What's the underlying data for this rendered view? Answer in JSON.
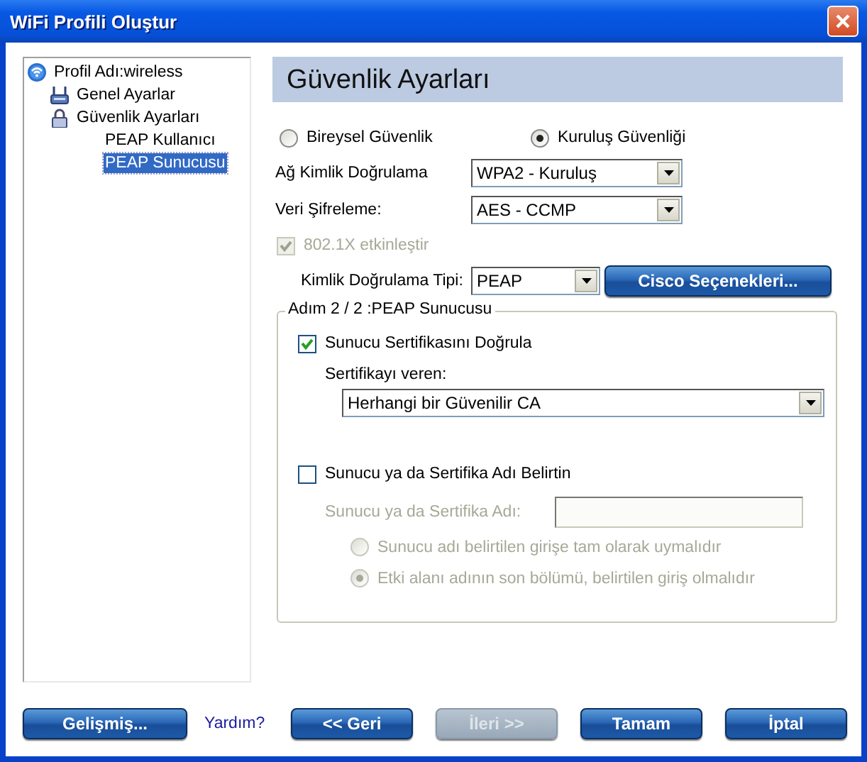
{
  "window": {
    "title": "WiFi Profili Oluştur"
  },
  "tree": [
    {
      "label": "Profil Adı:wireless",
      "selected": false,
      "children": [
        {
          "label": "Genel Ayarlar",
          "selected": false
        },
        {
          "label": "Güvenlik Ayarları",
          "selected": false,
          "children": [
            {
              "label": "PEAP Kullanıcı",
              "selected": false
            },
            {
              "label": "PEAP Sunucusu",
              "selected": true
            }
          ]
        }
      ]
    }
  ],
  "header": "Güvenlik Ayarları",
  "security_modes": [
    {
      "label": "Bireysel Güvenlik",
      "selected": false
    },
    {
      "label": "Kuruluş Güvenliği",
      "selected": true
    }
  ],
  "fields": [
    {
      "label": "Ağ Kimlik Doğrulama",
      "value": "WPA2 - Kuruluş"
    },
    {
      "label": "Veri Şifreleme:",
      "value": "AES - CCMP"
    }
  ],
  "enable_8021x": {
    "label": "802.1X etkinleştir",
    "checked": true,
    "disabled": true
  },
  "auth_type": {
    "label": "Kimlik Doğrulama Tipi:",
    "value": "PEAP"
  },
  "cisco_button": {
    "label": "Cisco Seçenekleri..."
  },
  "group": {
    "title": "Adım 2 / 2 :PEAP Sunucusu",
    "validate": {
      "label": "Sunucu Sertifikasını Doğrula",
      "checked": true
    },
    "issuer_label": "Sertifikayı veren:",
    "issuer": "Herhangi bir Güvenilir CA",
    "specify": {
      "label": "Sunucu ya da Sertifika Adı Belirtin",
      "checked": false
    },
    "name_field": {
      "label": "Sunucu ya da Sertifika Adı:",
      "disabled": true
    },
    "match_options": [
      {
        "label": "Sunucu adı belirtilen girişe tam olarak uymalıdır",
        "selected": false,
        "disabled": true
      },
      {
        "label": "Etki alanı adının son bölümü, belirtilen giriş olmalıdır",
        "selected": true,
        "disabled": true
      }
    ]
  },
  "advanced_button": {
    "label": "Gelişmiş...",
    "disabled": false
  },
  "help_link": "Yardım?",
  "nav_buttons": [
    {
      "label": "<< Geri",
      "disabled": false
    },
    {
      "label": "İleri >>",
      "disabled": true
    },
    {
      "label": "Tamam",
      "disabled": false
    },
    {
      "label": "İptal",
      "disabled": false
    }
  ]
}
